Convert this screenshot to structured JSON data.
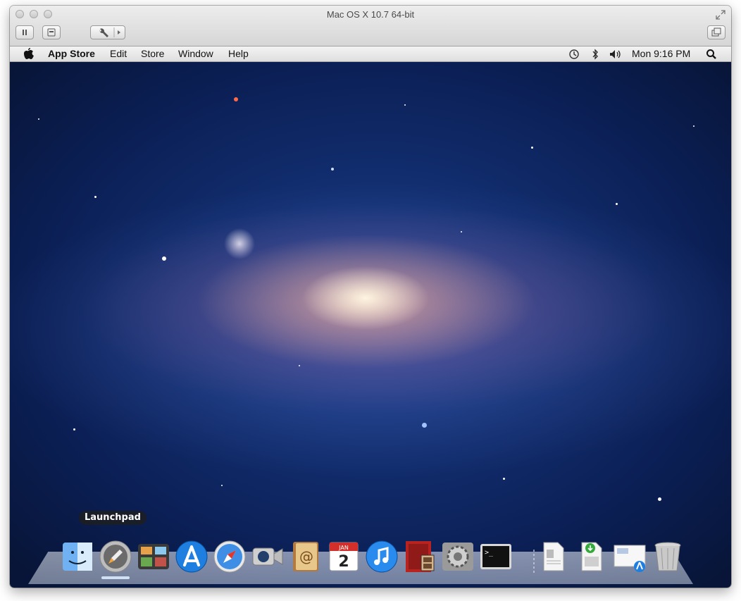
{
  "window": {
    "title": "Mac OS X 10.7 64-bit"
  },
  "toolbar": {
    "buttons": [
      "pause-icon",
      "snapshot-icon",
      "settings-wrench-icon",
      "fullscreen-toggle-icon"
    ]
  },
  "menubar": {
    "apple": "",
    "items": [
      "App Store",
      "Edit",
      "Store",
      "Window",
      "Help"
    ],
    "status": {
      "clock": "Mon 9:16 PM"
    },
    "status_icons": [
      "time-machine-icon",
      "bluetooth-icon",
      "volume-icon",
      "spotlight-icon"
    ]
  },
  "dock": {
    "tooltip": "Launchpad",
    "items": [
      {
        "name": "Finder",
        "icon": "finder-icon"
      },
      {
        "name": "Launchpad",
        "icon": "launchpad-icon",
        "running": true
      },
      {
        "name": "Mission Control",
        "icon": "mission-control-icon"
      },
      {
        "name": "App Store",
        "icon": "app-store-icon"
      },
      {
        "name": "Safari",
        "icon": "safari-icon"
      },
      {
        "name": "FaceTime",
        "icon": "facetime-icon"
      },
      {
        "name": "Address Book",
        "icon": "address-book-icon"
      },
      {
        "name": "iCal",
        "icon": "ical-icon",
        "month": "JAN",
        "day": "2"
      },
      {
        "name": "iTunes",
        "icon": "itunes-icon"
      },
      {
        "name": "Photo Booth",
        "icon": "photo-booth-icon"
      },
      {
        "name": "System Preferences",
        "icon": "system-preferences-icon"
      },
      {
        "name": "Terminal",
        "icon": "terminal-icon",
        "prompt": ">_"
      },
      {
        "name": "Document",
        "icon": "document-icon"
      },
      {
        "name": "Downloads",
        "icon": "downloads-icon"
      },
      {
        "name": "Applications",
        "icon": "applications-stack-icon"
      },
      {
        "name": "Trash",
        "icon": "trash-icon"
      }
    ]
  }
}
